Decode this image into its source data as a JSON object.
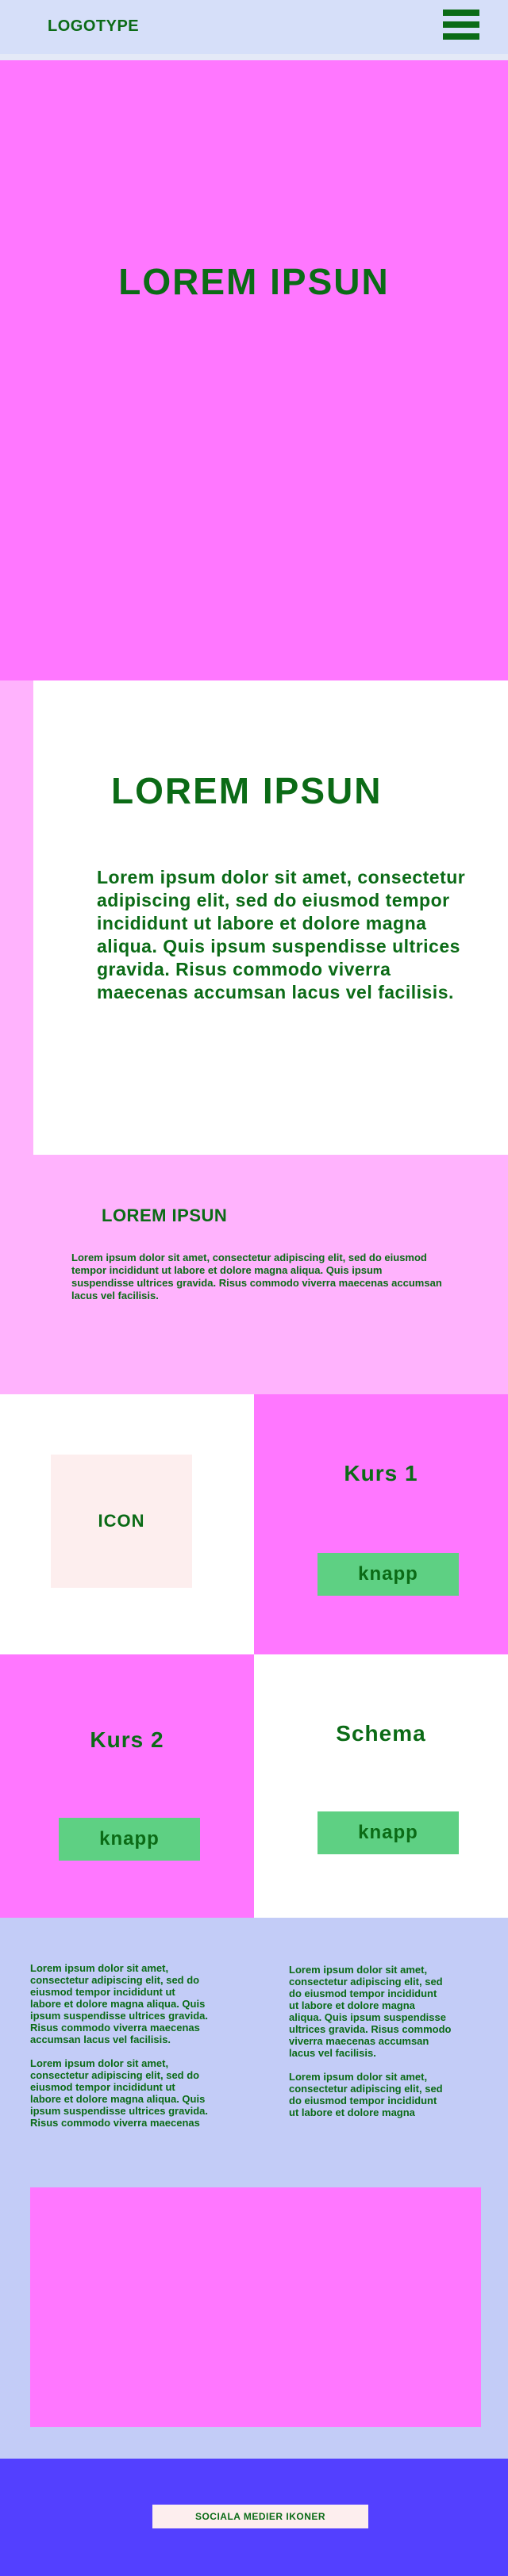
{
  "header": {
    "logo": "LOGOTYPE",
    "menu_icon": "hamburger-menu-icon"
  },
  "hero": {
    "title": "LOREM IPSUN"
  },
  "intro": {
    "title": "LOREM IPSUN",
    "text": "Lorem ipsum dolor sit amet, consectetur adipiscing elit, sed do eiusmod tempor incididunt ut labore et dolore magna aliqua. Quis ipsum suspendisse ultrices gravida. Risus commodo viverra maecenas accumsan lacus vel facilisis.",
    "subtitle": "LOREM IPSUN",
    "small_text": "Lorem ipsum dolor sit amet, consectetur adipiscing elit, sed do eiusmod tempor incididunt ut labore et dolore magna aliqua. Quis ipsum suspendisse ultrices gravida. Risus commodo viverra maecenas accumsan lacus vel facilisis."
  },
  "grid": {
    "icon_label": "ICON",
    "kurs1_title": "Kurs 1",
    "kurs1_button": "knapp",
    "kurs2_title": "Kurs 2",
    "kurs2_button": "knapp",
    "schema_title": "Schema",
    "schema_button": "knapp"
  },
  "columns": {
    "left": "Lorem ipsum dolor sit amet,\nconsectetur adipiscing elit, sed do\neiusmod tempor incididunt ut\nlabore et dolore magna aliqua. Quis\nipsum suspendisse ultrices gravida.\nRisus commodo viverra maecenas\naccumsan lacus vel facilisis.\n\nLorem ipsum dolor sit amet,\nconsectetur adipiscing elit, sed do\neiusmod tempor incididunt ut\nlabore et dolore magna aliqua. Quis\nipsum suspendisse ultrices gravida.\nRisus commodo viverra maecenas",
    "right": "Lorem ipsum dolor sit amet,\nconsectetur adipiscing elit, sed\ndo eiusmod tempor incididunt\nut labore et dolore magna\naliqua. Quis ipsum suspendisse\nultrices gravida. Risus commodo\nviverra maecenas accumsan\nlacus vel facilisis.\n\nLorem ipsum dolor sit amet,\nconsectetur adipiscing elit, sed\ndo eiusmod tempor incididunt\nut labore et dolore magna"
  },
  "footer": {
    "social": "SOCIALA MEDIER IKONER"
  },
  "colors": {
    "text_green": "#0b6b16",
    "header_bg": "#d6dff9",
    "pink": "#ff77ff",
    "light_pink": "#ffb3fd",
    "button_green": "#5ed083",
    "lavender": "#c3ccf7",
    "footer_blue": "#5340ff"
  }
}
